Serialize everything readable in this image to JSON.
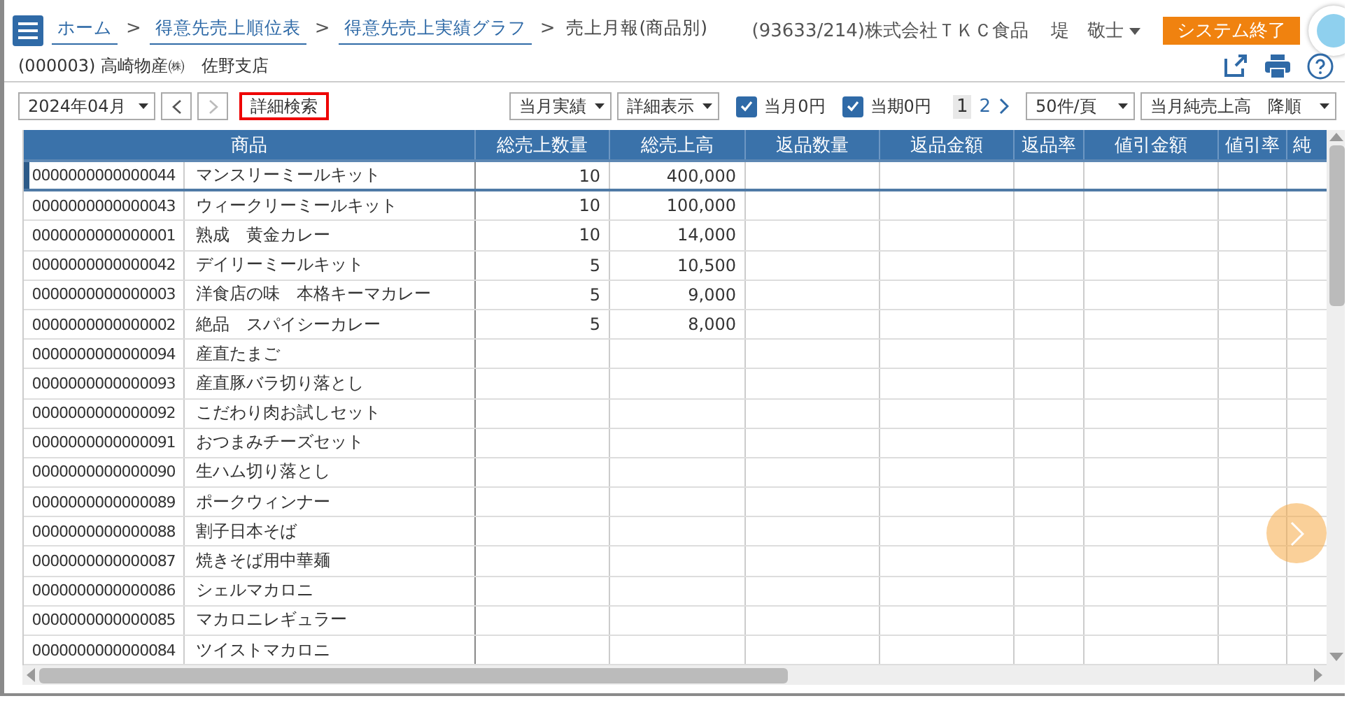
{
  "header": {
    "breadcrumbs": [
      {
        "label": "ホーム",
        "link": true
      },
      {
        "label": "得意先売上順位表",
        "link": true
      },
      {
        "label": "得意先売上実績グラフ",
        "link": true
      },
      {
        "label": "売上月報(商品別)",
        "link": false
      }
    ],
    "separator": ">",
    "company": "(93633/214)株式会社ＴＫＣ食品",
    "user": "堤　敬士",
    "exit_button": "システム終了"
  },
  "subheader": {
    "customer": "(000003) 高崎物産㈱　佐野支店"
  },
  "toolbar": {
    "month": "2024年04月",
    "search_button": "詳細検索",
    "period": "当月実績",
    "display": "詳細表示",
    "checkboxes": [
      {
        "label": "当月0円",
        "checked": true
      },
      {
        "label": "当期0円",
        "checked": true
      }
    ],
    "pages": [
      {
        "label": "1",
        "selected": true
      },
      {
        "label": "2",
        "selected": false
      }
    ],
    "page_size": "50件/頁",
    "sort": "当月純売上高　降順"
  },
  "table": {
    "columns": [
      "商品",
      "総売上数量",
      "総売上高",
      "返品数量",
      "返品金額",
      "返品率",
      "値引金額",
      "値引率",
      "純"
    ],
    "rows": [
      {
        "code": "0000000000000044",
        "name": "マンスリーミールキット",
        "quantity": "10",
        "sales": "400,000",
        "selected": true
      },
      {
        "code": "0000000000000043",
        "name": "ウィークリーミールキット",
        "quantity": "10",
        "sales": "100,000",
        "selected": false
      },
      {
        "code": "0000000000000001",
        "name": "熟成　黄金カレー",
        "quantity": "10",
        "sales": "14,000",
        "selected": false
      },
      {
        "code": "0000000000000042",
        "name": "デイリーミールキット",
        "quantity": "5",
        "sales": "10,500",
        "selected": false
      },
      {
        "code": "0000000000000003",
        "name": "洋食店の味　本格キーマカレー",
        "quantity": "5",
        "sales": "9,000",
        "selected": false
      },
      {
        "code": "0000000000000002",
        "name": "絶品　スパイシーカレー",
        "quantity": "5",
        "sales": "8,000",
        "selected": false
      },
      {
        "code": "0000000000000094",
        "name": "産直たまご",
        "selected": false
      },
      {
        "code": "0000000000000093",
        "name": "産直豚バラ切り落とし",
        "selected": false
      },
      {
        "code": "0000000000000092",
        "name": "こだわり肉お試しセット",
        "selected": false
      },
      {
        "code": "0000000000000091",
        "name": "おつまみチーズセット",
        "selected": false
      },
      {
        "code": "0000000000000090",
        "name": "生ハム切り落とし",
        "selected": false
      },
      {
        "code": "0000000000000089",
        "name": "ポークウィンナー",
        "selected": false
      },
      {
        "code": "0000000000000088",
        "name": "割子日本そば",
        "selected": false
      },
      {
        "code": "0000000000000087",
        "name": "焼きそば用中華麺",
        "selected": false
      },
      {
        "code": "0000000000000086",
        "name": "シェルマカロニ",
        "selected": false
      },
      {
        "code": "0000000000000085",
        "name": "マカロニレギュラー",
        "selected": false
      },
      {
        "code": "0000000000000084",
        "name": "ツイストマカロニ",
        "selected": false
      }
    ]
  }
}
